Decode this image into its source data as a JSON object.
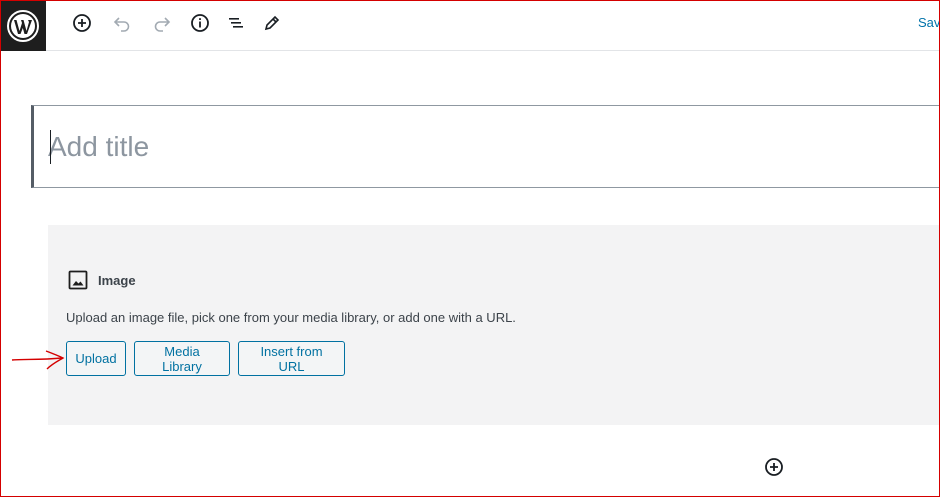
{
  "toolbar": {
    "save_label": "Sav",
    "icons": [
      "wordpress-logo-icon",
      "add-block-icon",
      "undo-icon",
      "redo-icon",
      "info-icon",
      "outline-icon",
      "edit-pencil-icon"
    ]
  },
  "title": {
    "placeholder": "Add title",
    "value": ""
  },
  "image_block": {
    "label": "Image",
    "instructions": "Upload an image file, pick one from your media library, or add one with a URL.",
    "buttons": {
      "upload": "Upload",
      "media_library": "Media Library",
      "insert_url": "Insert from URL"
    }
  },
  "colors": {
    "accent": "#0071a1",
    "toolbar_dark": "#1e1e1e",
    "annotation": "#d40000",
    "block_background": "#f3f3f4"
  }
}
